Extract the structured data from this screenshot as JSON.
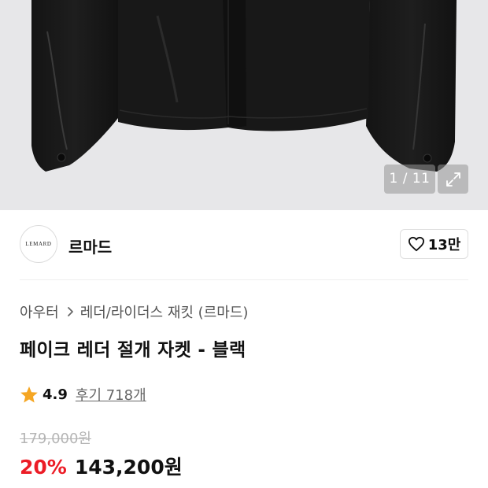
{
  "gallery": {
    "counter": "1 / 11",
    "icons": {
      "expand": "expand-icon"
    }
  },
  "brand": {
    "logo_text": "LEMARD",
    "name": "르마드",
    "like_count": "13만",
    "icons": {
      "like": "heart-icon"
    }
  },
  "breadcrumb": {
    "items": [
      "아우터",
      "레더/라이더스 재킷 (르마드)"
    ],
    "icons": {
      "separator": "chevron-right-icon"
    }
  },
  "product": {
    "title": "페이크 레더 절개 자켓 - 블랙"
  },
  "rating": {
    "score": "4.9",
    "reviews": "후기 718개",
    "icons": {
      "star": "star-icon"
    }
  },
  "price": {
    "original": "179,000원",
    "discount": "20%",
    "sale": "143,200원"
  },
  "colors": {
    "discount": "#ec1c26",
    "star": "#f5a623",
    "hero_bg": "#e7e7e9"
  }
}
